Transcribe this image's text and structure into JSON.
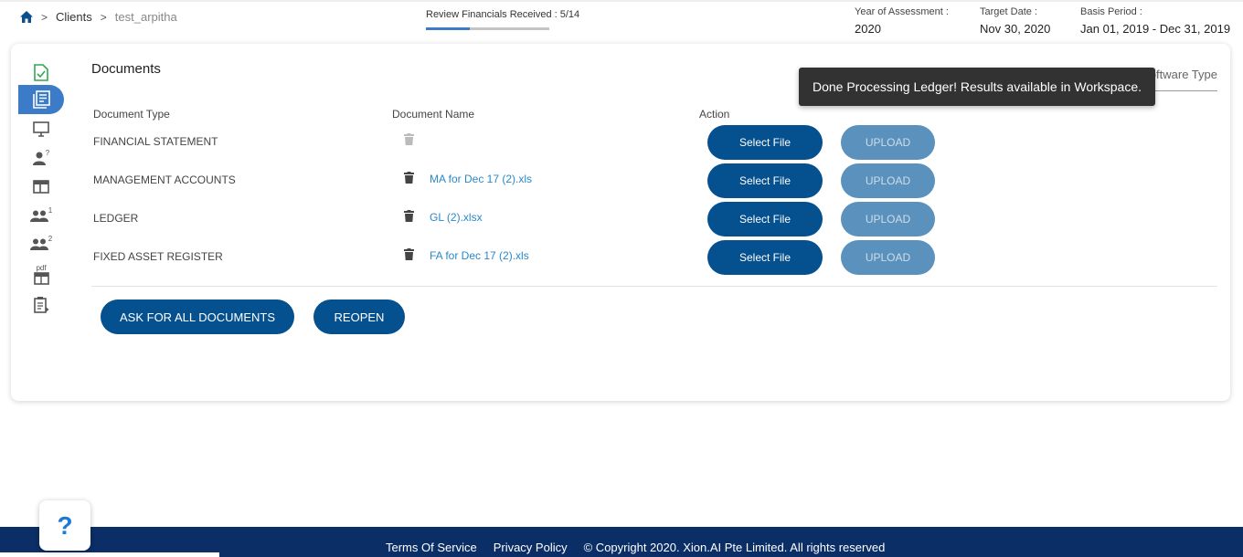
{
  "breadcrumb": {
    "home_icon": "home-icon",
    "items": [
      "Clients",
      "test_arpitha"
    ]
  },
  "progress": {
    "label": "Review Financials Received : 5/14",
    "completed": 5,
    "total": 14
  },
  "meta": {
    "year_label": "Year of Assessment :",
    "year_value": "2020",
    "target_label": "Target Date :",
    "target_value": "Nov 30, 2020",
    "basis_label": "Basis Period :",
    "basis_value": "Jan 01, 2019 - Dec 31, 2019"
  },
  "sidebar": {
    "icons": [
      "checklist-icon",
      "documents-icon",
      "monitor-icon",
      "user-question-icon",
      "layout-icon",
      "people-1-icon",
      "people-2-icon",
      "pdf-icon",
      "clipboard-icon"
    ],
    "active_index": 1,
    "sup1": "1",
    "sup2": "2",
    "sup_q": "?",
    "pdf_label": "pdf"
  },
  "documents": {
    "title": "Documents",
    "software_type_label": "Software Type",
    "headers": {
      "type": "Document Type",
      "name": "Document Name",
      "action": "Action"
    },
    "rows": [
      {
        "type": "FINANCIAL STATEMENT",
        "name": "",
        "select_label": "Select File",
        "upload_label": "UPLOAD"
      },
      {
        "type": "MANAGEMENT ACCOUNTS",
        "name": "MA for Dec 17 (2).xls",
        "select_label": "Select File",
        "upload_label": "UPLOAD"
      },
      {
        "type": "LEDGER",
        "name": "GL (2).xlsx",
        "select_label": "Select File",
        "upload_label": "UPLOAD"
      },
      {
        "type": "FIXED ASSET REGISTER",
        "name": "FA for Dec 17 (2).xls",
        "select_label": "Select File",
        "upload_label": "UPLOAD"
      }
    ],
    "ask_all_label": "ASK FOR ALL DOCUMENTS",
    "reopen_label": "REOPEN"
  },
  "toast": {
    "message": "Done Processing Ledger! Results available in Workspace."
  },
  "help": {
    "label": "?"
  },
  "footer": {
    "terms": "Terms Of Service",
    "privacy": "Privacy Policy",
    "copyright": "© Copyright 2020. Xion.AI Pte Limited. All rights reserved"
  },
  "colors": {
    "primary": "#05508f",
    "upload_disabled": "#5b91bd",
    "link": "#2a88c9",
    "footer": "#0b2e66",
    "active_tab": "#3b7bc7"
  }
}
